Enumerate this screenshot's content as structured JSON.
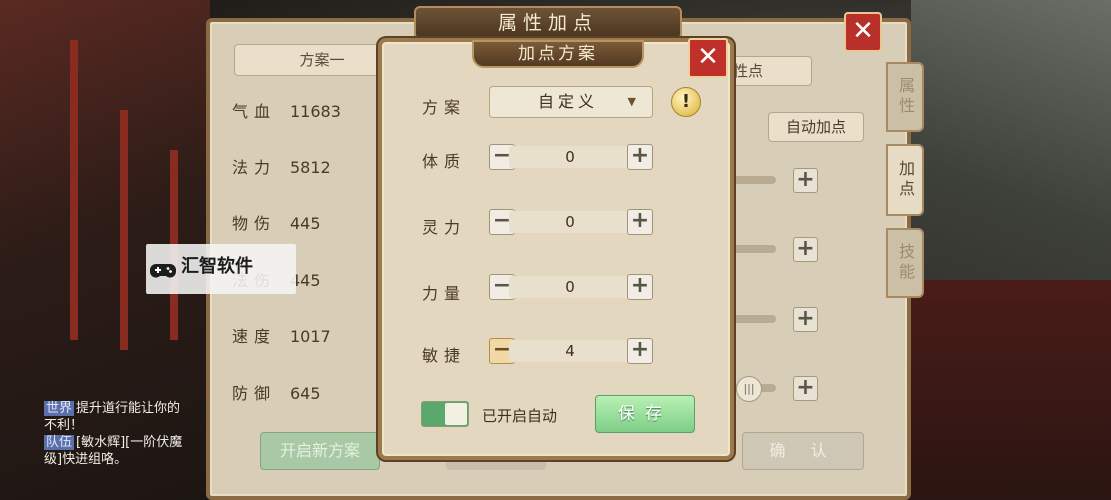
{
  "main_window": {
    "title": "属性加点",
    "close_symbol": "✕",
    "side_tabs": [
      "属性",
      "加点",
      "技能"
    ],
    "left_panel": {
      "plan_button": "方案一",
      "stats": [
        {
          "label": "气血",
          "value": "11683"
        },
        {
          "label": "法力",
          "value": "5812"
        },
        {
          "label": "物伤",
          "value": "445"
        },
        {
          "label": "法伤",
          "value": "445"
        },
        {
          "label": "速度",
          "value": "1017"
        },
        {
          "label": "防御",
          "value": "645"
        }
      ],
      "new_plan_button": "开启新方案"
    },
    "right_panel": {
      "tab_text": "性点",
      "auto_add_button": "自动加点",
      "confirm_button": "确 认"
    }
  },
  "modal": {
    "title": "加点方案",
    "close_symbol": "✕",
    "plan_label": "方案",
    "plan_value": "自定义",
    "plan_arrow": "▼",
    "warn_symbol": "!",
    "attributes": [
      {
        "label": "体质",
        "value": "0"
      },
      {
        "label": "灵力",
        "value": "0"
      },
      {
        "label": "力量",
        "value": "0"
      },
      {
        "label": "敏捷",
        "value": "4"
      }
    ],
    "minus_symbol": "−",
    "plus_symbol": "+",
    "auto_label": "已开启自动",
    "auto_enabled": true,
    "save_button": "保存"
  },
  "chat": {
    "lines": [
      {
        "tag": "世界",
        "text": "提升道行能让你的"
      },
      {
        "tag": "",
        "text": "不利！"
      },
      {
        "tag": "队伍",
        "text": "[敏水辉][一阶伏魔"
      },
      {
        "tag": "",
        "text": "级]快进组咯。"
      }
    ]
  },
  "watermark": {
    "text": "汇智软件",
    "icon": "gamepad-icon"
  },
  "colors": {
    "save": "#7fce88",
    "close": "#c0302a",
    "toggle_on": "#5aa86c",
    "frame": "#9b7b4c"
  }
}
